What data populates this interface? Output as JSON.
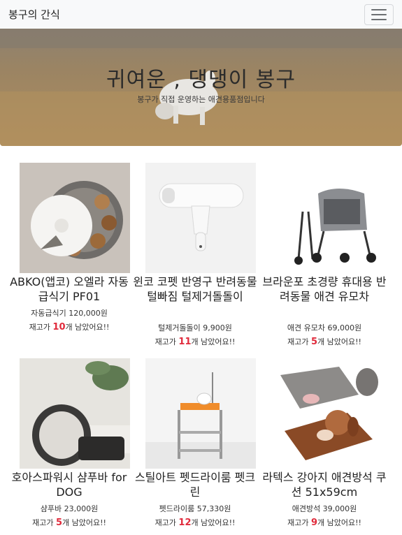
{
  "navbar": {
    "brand": "봉구의 간식",
    "toggle_icon": "hamburger-menu-icon"
  },
  "hero": {
    "title": "귀여운 , 댕댕이 봉구",
    "subtitle": "봉구가 직접 운영하는 애견용품점입니다",
    "colors": {
      "ground": "#a8875a",
      "sky": "#8a7b67"
    }
  },
  "products": [
    {
      "name": "ABKO(앱코) 오엘라 자동급식기 PF01",
      "desc": "자동급식기 120,000원",
      "stock_prefix": "재고가 ",
      "stock": "10",
      "stock_suffix": "개 남았어요!!"
    },
    {
      "name": "윈코 코펫 반영구 반려동물 털빠짐 털제거돌돌이",
      "desc": "털제거돌돌이 9,900원",
      "stock_prefix": "재고가 ",
      "stock": "11",
      "stock_suffix": "개 남았어요!!"
    },
    {
      "name": "브라운포 초경량 휴대용 반려동물 애견 유모차",
      "desc": "애견 유모차 69,000원",
      "stock_prefix": "재고가 ",
      "stock": "5",
      "stock_suffix": "개 남았어요!!"
    },
    {
      "name": "호아스파워시 샴푸바 for DOG",
      "desc": "샴푸바 23,000원",
      "stock_prefix": "재고가 ",
      "stock": "5",
      "stock_suffix": "개 남았어요!!"
    },
    {
      "name": "스틸아트 펫드라이룸 펫크린",
      "desc": "펫드라이룸 57,330원",
      "stock_prefix": "재고가 ",
      "stock": "12",
      "stock_suffix": "개 남았어요!!"
    },
    {
      "name": "라텍스 강아지 애견방석 쿠션 51x59cm",
      "desc": "애견방석 39,000원",
      "stock_prefix": "재고가 ",
      "stock": "9",
      "stock_suffix": "개 남았어요!!"
    }
  ],
  "accent_color": "#e02a3b"
}
